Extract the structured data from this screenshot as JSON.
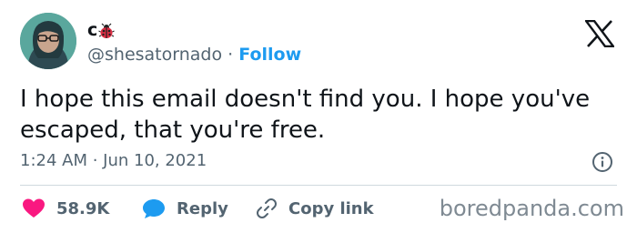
{
  "tweet": {
    "display_name": "c",
    "name_emoji": "ladybug-icon",
    "handle": "@shesatornado",
    "separator": "·",
    "follow_label": "Follow",
    "text": "I hope this email doesn't find you. I hope you've escaped, that you're free.",
    "timestamp": "1:24 AM · Jun 10, 2021",
    "actions": {
      "like_count": "58.9K",
      "reply_label": "Reply",
      "copy_link_label": "Copy link"
    }
  },
  "brand": {
    "logo": "x-logo",
    "watermark": "boredpanda.com"
  },
  "colors": {
    "link": "#1d9bf0",
    "heart": "#f91880",
    "reply": "#1d9bf0",
    "secondary_text": "#536471",
    "divider": "#cfd9de"
  }
}
